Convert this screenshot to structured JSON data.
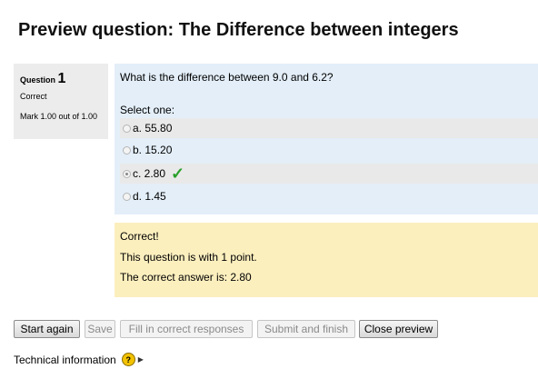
{
  "page_title": "Preview question: The Difference between integers",
  "question_info": {
    "label": "Question",
    "number": "1",
    "state": "Correct",
    "grade": "Mark 1.00 out of 1.00"
  },
  "question": {
    "text": "What is the difference between 9.0 and 6.2?",
    "prompt": "Select one:",
    "options": [
      {
        "label": "a. 55.80",
        "selected": false
      },
      {
        "label": "b. 15.20",
        "selected": false
      },
      {
        "label": "c. 2.80",
        "selected": true,
        "correct": true
      },
      {
        "label": "d. 1.45",
        "selected": false
      }
    ],
    "check_icon": "check-icon",
    "check_color": "#2aa02a"
  },
  "outcome": {
    "feedback": "Correct!",
    "points": "This question is with 1 point.",
    "right_answer": "The correct answer is: 2.80"
  },
  "buttons": {
    "start_again": "Start again",
    "save": "Save",
    "fill_correct": "Fill in correct responses",
    "submit_finish": "Submit and finish",
    "close_preview": "Close preview"
  },
  "technical_info": {
    "label": "Technical information",
    "help_icon": "help-icon",
    "expand_icon": "expand-arrow-icon"
  },
  "colors": {
    "formulation_bg": "#e3eef8",
    "outcome_bg": "#fcefbe",
    "info_bg": "#ececec"
  }
}
